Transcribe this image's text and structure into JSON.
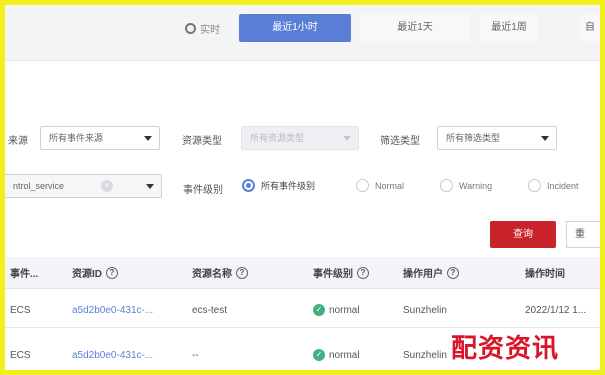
{
  "time_range": {
    "live_label": "实时",
    "buttons": [
      "最近1小时",
      "最近1天",
      "最近1周",
      "自"
    ]
  },
  "filters": {
    "source_label": "来源",
    "source_value": "所有事件来源",
    "resource_type_label": "资源类型",
    "resource_type_value": "所有资源类型",
    "filter_type_label": "筛选类型",
    "filter_type_value": "所有筛选类型",
    "service_value": "ntrol_service",
    "event_level_label": "事件级别",
    "levels": [
      "所有事件级别",
      "Normal",
      "Warning",
      "Incident"
    ],
    "query_label": "查询",
    "reset_label": "重"
  },
  "table": {
    "headers": [
      "事件...",
      "资源ID",
      "资源名称",
      "事件级别",
      "操作用户",
      "操作时间"
    ],
    "rows": [
      {
        "source": "ECS",
        "resource_id": "a5d2b0e0-431c-...",
        "resource_name": "ecs-test",
        "level": "normal",
        "user": "Sunzhelin",
        "time": "2022/1/12 1..."
      },
      {
        "source": "ECS",
        "resource_id": "a5d2b0e0-431c-...",
        "resource_name": "--",
        "level": "normal",
        "user": "Sunzhelin",
        "time": ""
      }
    ]
  },
  "watermark": "配资资讯",
  "colors": {
    "accent": "#5b7fd6",
    "danger": "#c8222b",
    "ok": "#3fb27f",
    "frame": "#f2ef1a"
  }
}
